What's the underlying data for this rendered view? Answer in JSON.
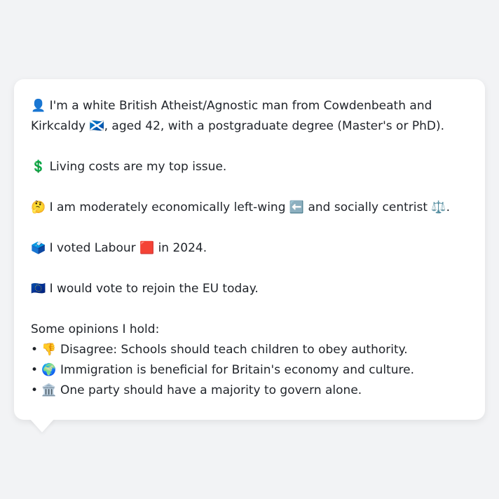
{
  "bubble": {
    "intro_line": "👤 I'm a white British Atheist/Agnostic man from Cowdenbeath and Kirkcaldy 🏴󠁧󠁢󠁳󠁣󠁴󠁿, aged 42, with a postgraduate degree (Master's or PhD).",
    "issue_line": "💲 Living costs are my top issue.",
    "ideology_line": "🤔 I am moderately economically left-wing ⬅️ and socially centrist ⚖️.",
    "vote_line": "🗳️ I voted Labour 🟥 in 2024.",
    "eu_line": "🇪🇺 I would vote to rejoin the EU today.",
    "opinions_heading": "Some opinions I hold:",
    "opinions": [
      "• 👎 Disagree: Schools should teach children to obey authority.",
      "• 🌍 Immigration is beneficial for Britain's economy and culture.",
      "• 🏛️ One party should have a majority to govern alone."
    ]
  }
}
